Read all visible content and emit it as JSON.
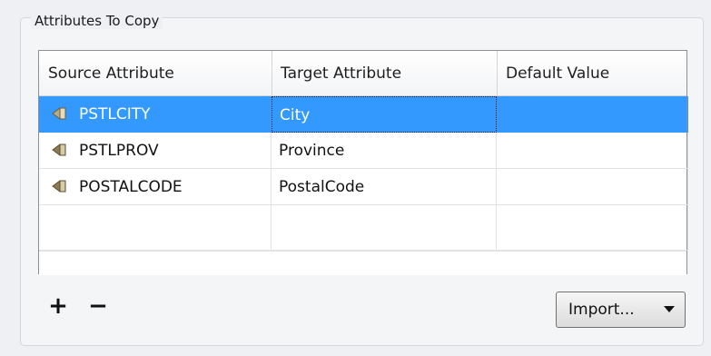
{
  "group": {
    "title": "Attributes To Copy"
  },
  "table": {
    "columns": [
      "Source Attribute",
      "Target Attribute",
      "Default Value"
    ],
    "rows": [
      {
        "source": "PSTLCITY",
        "target": "City",
        "default": "",
        "selected": true
      },
      {
        "source": "PSTLPROV",
        "target": "Province",
        "default": "",
        "selected": false
      },
      {
        "source": "POSTALCODE",
        "target": "PostalCode",
        "default": "",
        "selected": false
      }
    ]
  },
  "toolbar": {
    "add_label": "+",
    "remove_label": "−",
    "import_label": "Import..."
  },
  "icons": {
    "attribute": "attribute-tag-icon",
    "dropdown": "chevron-down-icon"
  },
  "colors": {
    "selection": "#3399ff",
    "icon": "#8a7a55"
  }
}
